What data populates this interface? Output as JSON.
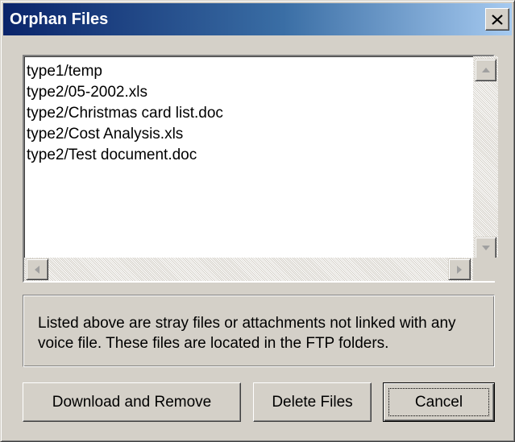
{
  "window": {
    "title": "Orphan Files",
    "close_icon": "close-icon"
  },
  "file_list": {
    "items": [
      "type1/temp",
      "type2/05-2002.xls",
      "type2/Christmas card list.doc",
      "type2/Cost Analysis.xls",
      "type2/Test document.doc"
    ]
  },
  "info": {
    "text": "Listed above are stray files or attachments not linked with any voice file.  These files are located in the FTP folders."
  },
  "buttons": {
    "download_remove": "Download and Remove",
    "delete_files": "Delete Files",
    "cancel": "Cancel"
  },
  "colors": {
    "title_gradient_start": "#0a246a",
    "title_gradient_end": "#a6caf0",
    "face": "#d4d0c8"
  }
}
